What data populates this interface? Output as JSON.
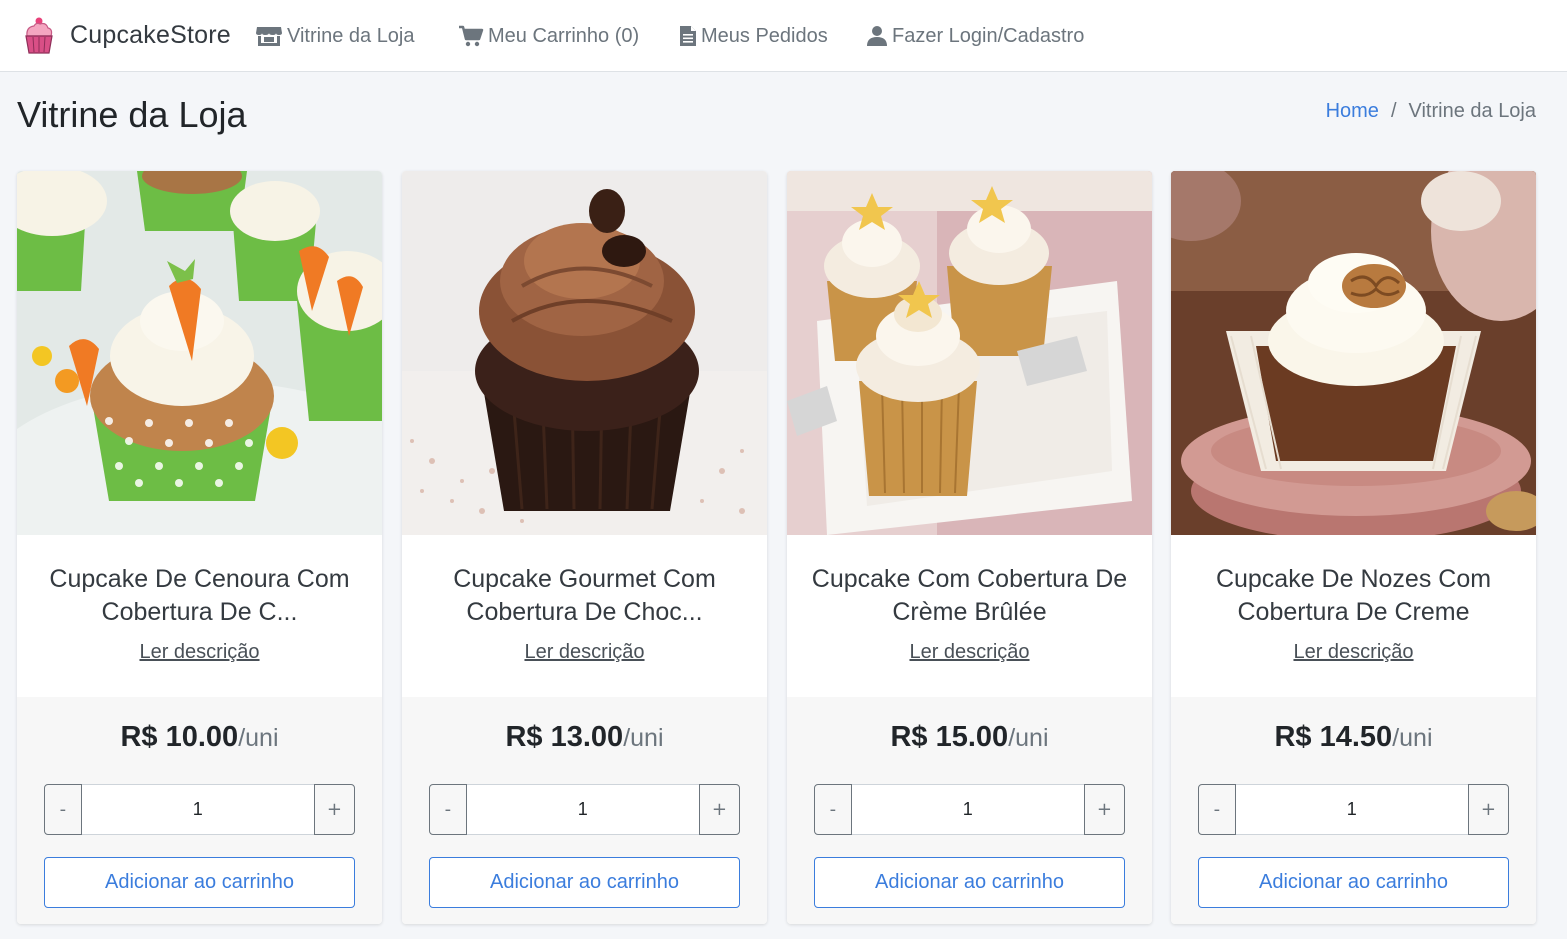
{
  "navbar": {
    "brand": "CupcakeStore",
    "links": {
      "store": "Vitrine da Loja",
      "cart": "Meu Carrinho (0)",
      "orders": "Meus Pedidos",
      "login": "Fazer Login/Cadastro"
    }
  },
  "page": {
    "title": "Vitrine da Loja",
    "breadcrumb": {
      "home": "Home",
      "separator": "/",
      "current": "Vitrine da Loja"
    }
  },
  "products": [
    {
      "name": "Cupcake De Cenoura Com Cobertura De C...",
      "description_link": "Ler descrição",
      "price": "R$ 10.00",
      "unit": "/uni",
      "quantity": "1",
      "minus": "-",
      "plus": "+",
      "add_label": "Adicionar ao carrinho"
    },
    {
      "name": "Cupcake Gourmet Com Cobertura De Choc...",
      "description_link": "Ler descrição",
      "price": "R$ 13.00",
      "unit": "/uni",
      "quantity": "1",
      "minus": "-",
      "plus": "+",
      "add_label": "Adicionar ao carrinho"
    },
    {
      "name": "Cupcake Com Cobertura De Crème Brûlée",
      "description_link": "Ler descrição",
      "price": "R$ 15.00",
      "unit": "/uni",
      "quantity": "1",
      "minus": "-",
      "plus": "+",
      "add_label": "Adicionar ao carrinho"
    },
    {
      "name": "Cupcake De Nozes Com Cobertura De Creme",
      "description_link": "Ler descrição",
      "price": "R$ 14.50",
      "unit": "/uni",
      "quantity": "1",
      "minus": "-",
      "plus": "+",
      "add_label": "Adicionar ao carrinho"
    }
  ],
  "colors": {
    "accent": "#3b7ddd",
    "muted": "#6c757d",
    "page_bg": "#f4f6f9"
  }
}
